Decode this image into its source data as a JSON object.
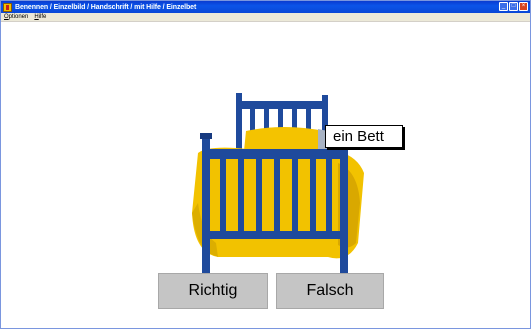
{
  "window": {
    "title": "Benennen / Einzelbild / Handschrift / mit Hilfe / Einzelbet",
    "controls": [
      "_",
      "□",
      "×"
    ]
  },
  "menu": {
    "items": [
      {
        "first": "O",
        "rest": "ptionen"
      },
      {
        "first": "H",
        "rest": "ilfe"
      }
    ]
  },
  "picture": {
    "subject": "bed-image",
    "label": "ein Bett"
  },
  "buttons": {
    "correct": "Richtig",
    "wrong": "Falsch"
  },
  "colors": {
    "bed_frame": "#1f4a9c",
    "bedding": "#f2c200",
    "button_bg": "#c5c5c5",
    "titlebar": "#0b54e8"
  }
}
